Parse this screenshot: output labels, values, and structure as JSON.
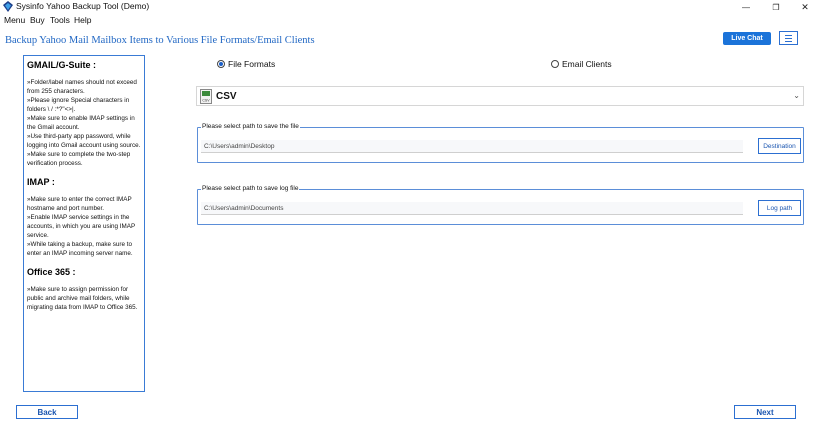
{
  "window": {
    "title": "Sysinfo Yahoo Backup Tool (Demo)",
    "minimize_glyph": "—",
    "maximize_glyph": "❐",
    "close_glyph": "✕"
  },
  "menubar": {
    "items": [
      "Menu",
      "Buy",
      "Tools",
      "Help"
    ]
  },
  "header": {
    "title": "Backup Yahoo Mail Mailbox Items to Various File Formats/Email Clients",
    "live_chat": "Live Chat"
  },
  "info_panel": {
    "sections": [
      {
        "heading": "GMAIL/G-Suite :",
        "text": "»Folder/label names should not exceed from 255 characters.\n»Please ignore Special characters in folders  \\ / :*?\"<>|.\n»Make sure to enable IMAP settings in the Gmail account.\n»Use third-party app password, while logging into Gmail account using source.\n»Make sure to complete the two-step verification process."
      },
      {
        "heading": "IMAP :",
        "text": "»Make sure to enter the correct IMAP hostname and port number.\n»Enable IMAP service settings in the accounts, in which you are using IMAP service.\n»While taking a backup, make sure to enter an IMAP incoming server name."
      },
      {
        "heading": "Office 365 :",
        "text": "»Make sure to assign permission for public and archive mail folders, while migrating data from IMAP to Office 365."
      }
    ]
  },
  "options": {
    "file_formats": "File Formats",
    "email_clients": "Email Clients",
    "selected": "file_formats"
  },
  "format_select": {
    "selected": "CSV",
    "icon_caption": "CSV"
  },
  "save_path": {
    "legend": "Please select path to save the file",
    "value": "C:\\Users\\admin\\Desktop",
    "button": "Destination"
  },
  "log_path": {
    "legend": "Please select path to save log file",
    "value": "C:\\Users\\admin\\Documents",
    "button": "Log path"
  },
  "footer": {
    "back": "Back",
    "next": "Next"
  },
  "colors": {
    "accent": "#2c6fd1",
    "header_title": "#2268c4",
    "live_chat_bg": "#1b73d9"
  }
}
